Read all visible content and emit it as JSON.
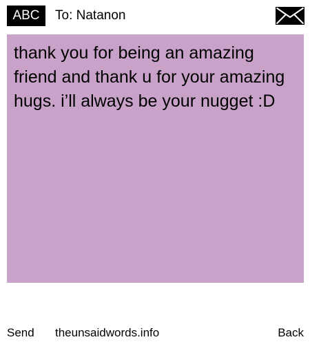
{
  "header": {
    "keyboard_mode": "ABC",
    "recipient": "To: Natanon"
  },
  "message": {
    "text": "thank you for being an amazing friend and thank u for your amazing hugs. i’ll always be your nugget :D"
  },
  "footer": {
    "send_label": "Send",
    "site_label": "theunsaidwords.info",
    "back_label": "Back"
  },
  "colors": {
    "message_background": "#c8a2c8",
    "badge_background": "#000000",
    "badge_text": "#ffffff"
  },
  "icons": {
    "envelope": "envelope-icon"
  }
}
